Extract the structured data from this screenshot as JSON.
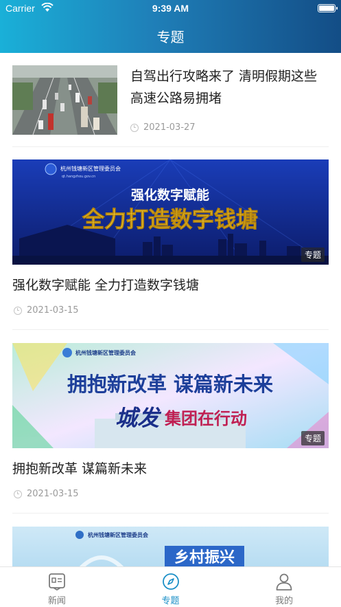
{
  "status_bar": {
    "carrier": "Carrier",
    "time": "9:39 AM"
  },
  "header": {
    "title": "专题"
  },
  "articles": [
    {
      "title": "自驾出行攻略来了 清明假期这些高速公路易拥堵",
      "date": "2021-03-27",
      "image": "highway-traffic-photo"
    },
    {
      "title": "强化数字赋能 全力打造数字钱塘",
      "date": "2021-03-15",
      "tag": "专题",
      "banner": {
        "org": "杭州钱塘新区管理委员会",
        "site": "qt.hangzhou.gov.cn",
        "line1": "强化数字赋能",
        "line2": "全力打造数字钱塘"
      }
    },
    {
      "title": "拥抱新改革 谋篇新未来",
      "date": "2021-03-15",
      "tag": "专题",
      "banner": {
        "org": "杭州钱塘新区管理委员会",
        "line1": "拥抱新改革 谋篇新未来",
        "line2a": "城发",
        "line2b": "集团在行动"
      }
    },
    {
      "banner": {
        "org": "杭州钱塘新区管理委员会",
        "line1": "乡村振兴"
      }
    }
  ],
  "tabbar": {
    "items": [
      {
        "label": "新闻",
        "icon": "news-icon",
        "active": false
      },
      {
        "label": "专题",
        "icon": "compass-icon",
        "active": true
      },
      {
        "label": "我的",
        "icon": "user-icon",
        "active": false
      }
    ]
  },
  "colors": {
    "accent": "#1a8fc7",
    "header_start": "#1ab0d8",
    "header_end": "#134d86"
  }
}
